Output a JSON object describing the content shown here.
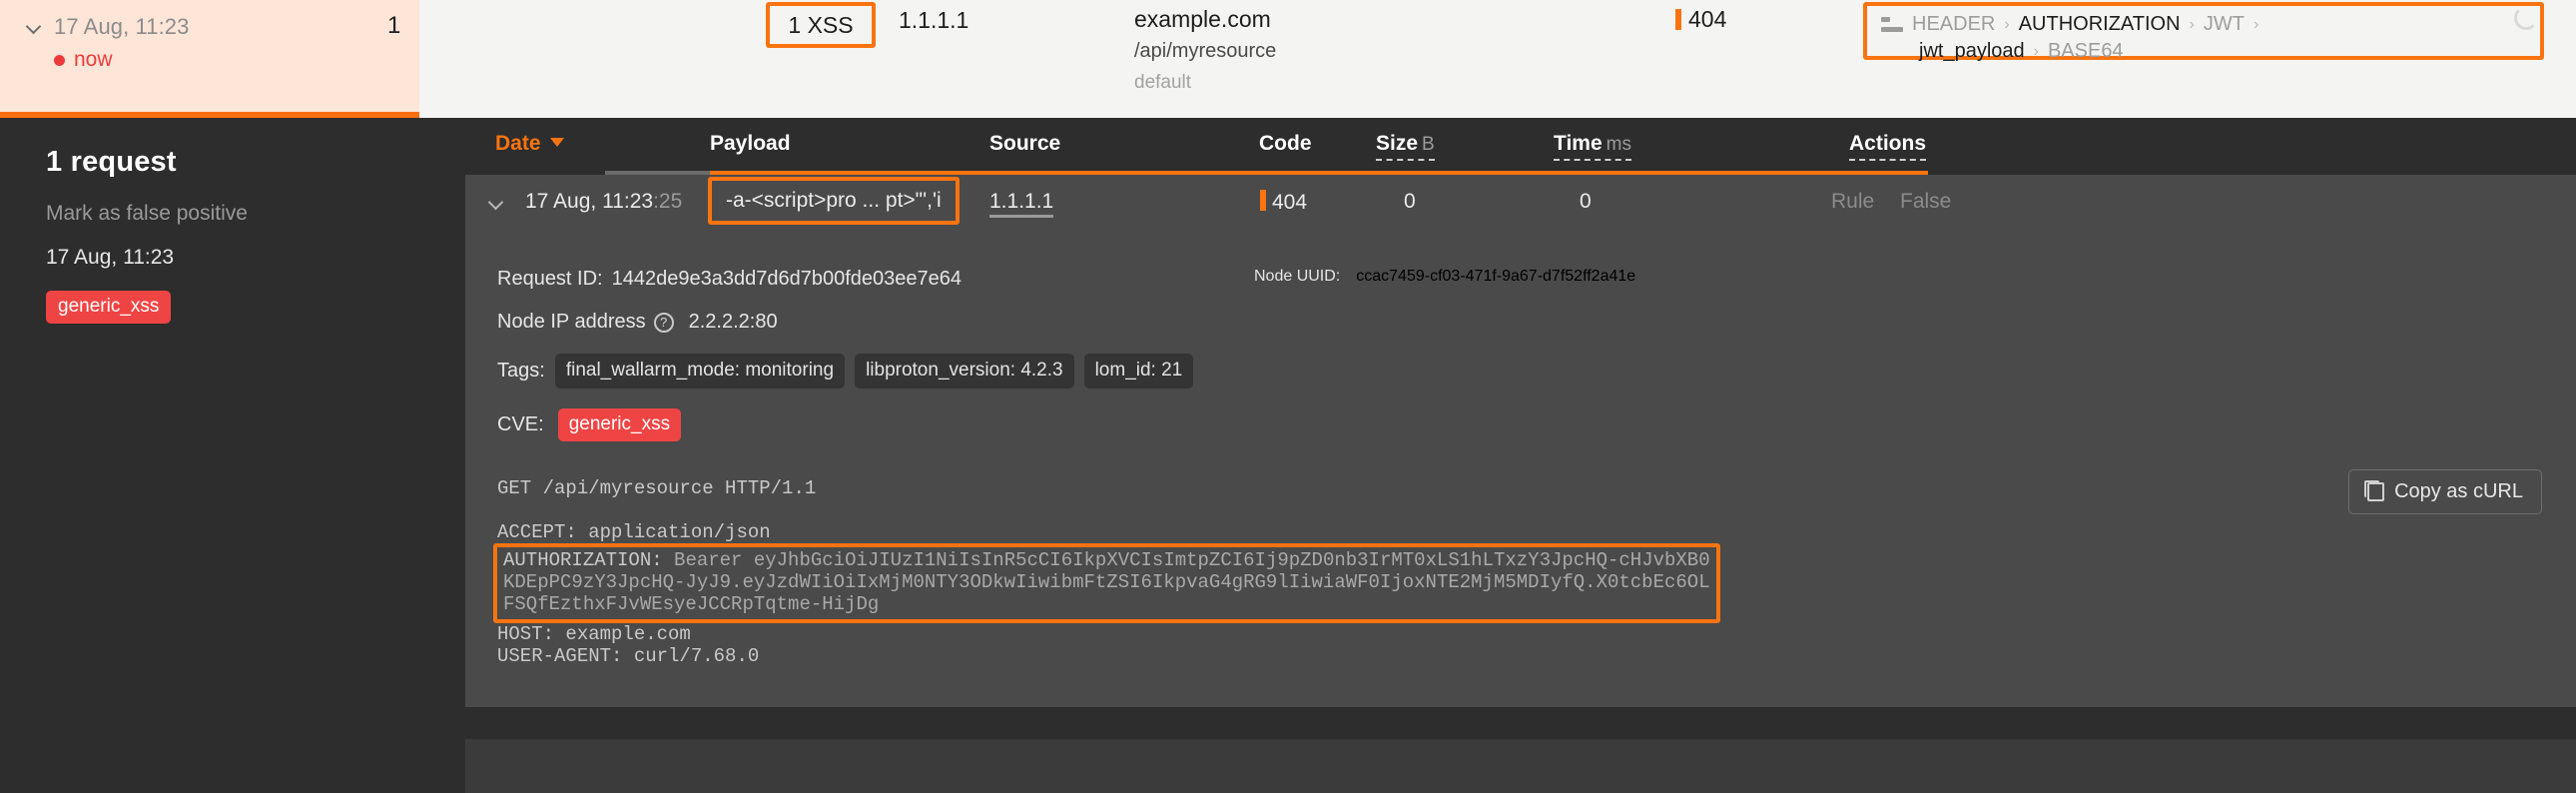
{
  "top_summary": {
    "expand_icon": "chevron-down-icon",
    "date": "17 Aug, 11:23",
    "status_dot": "red-dot-icon",
    "status_text": "now",
    "count": "1",
    "attack_chip": "1 XSS",
    "source_ip": "1.1.1.1",
    "domain": "example.com",
    "path": "/api/myresource",
    "branch": "default",
    "response_code": "404",
    "breadcrumb": {
      "icon": "header-lines-icon",
      "part1": "HEADER",
      "sep1": "›",
      "part2": "AUTHORIZATION",
      "sep2": "›",
      "part3": "JWT",
      "sep3": "›",
      "part4": "jwt_payload",
      "sep4": "›",
      "part5": "BASE64"
    },
    "loading_icon": "spinner-icon"
  },
  "sidebar": {
    "title": "1 request",
    "false_positive_label": "Mark as false positive",
    "date": "17 Aug, 11:23",
    "tag": "generic_xss"
  },
  "table": {
    "headers": {
      "date": "Date",
      "date_sort_icon": "caret-down-icon",
      "payload": "Payload",
      "source": "Source",
      "code": "Code",
      "size": "Size",
      "size_unit": "B",
      "time": "Time",
      "time_unit": "ms",
      "actions": "Actions"
    },
    "row": {
      "expand_icon": "chevron-down-icon",
      "date_main": "17 Aug, 11:23",
      "date_seconds": ":25",
      "payload": "-a-<script>pro ... pt>\"','i",
      "source": "1.1.1.1",
      "code": "404",
      "size": "0",
      "time": "0",
      "action_rule": "Rule",
      "action_false": "False"
    }
  },
  "detail": {
    "request_id_label": "Request ID:",
    "request_id": "1442de9e3a3dd7d6d7b00fde03ee7e64",
    "node_ip_label": "Node IP address",
    "node_ip_help_icon": "question-mark-icon",
    "node_ip": "2.2.2.2:80",
    "node_uuid_label": "Node UUID:",
    "node_uuid": "ccac7459-cf03-471f-9a67-d7f52ff2a41e",
    "tags_label": "Tags:",
    "tags": [
      "final_wallarm_mode: monitoring",
      "libproton_version: 4.2.3",
      "lom_id: 21"
    ],
    "cve_label": "CVE:",
    "cve": "generic_xss",
    "copy_button": "Copy as cURL",
    "copy_icon": "copy-icon",
    "raw": {
      "line1": "GET /api/myresource HTTP/1.1",
      "line2": "ACCEPT: application/json",
      "auth_key": "AUTHORIZATION:",
      "auth_value": " Bearer eyJhbGciOiJIUzI1NiIsInR5cCI6IkpXVCIsImtpZCI6Ij9pZD0nb3IrMT0xLS1hLTxzY3JpcHQ-cHJvbXB0KDEpPC9zY3JpcHQ-JyJ9.eyJzdWIiOiIxMjM0NTY3ODkwIiwibmFtZSI6IkpvaG4gRG9lIiwiaWF0IjoxNTE2MjM5MDIyfQ.X0tcbEc6OLFSQfEzthxFJvWEsyeJCCRpTqtme-HijDg",
      "line4": "HOST: example.com",
      "line5": "USER-AGENT: curl/7.68.0"
    }
  }
}
